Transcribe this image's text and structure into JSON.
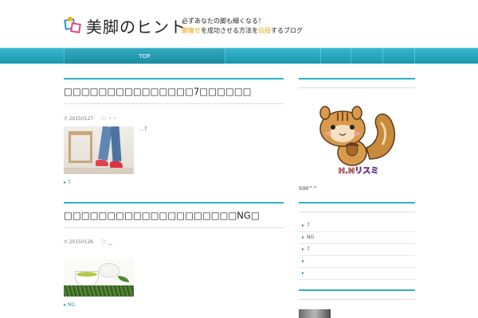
{
  "header": {
    "site_title": "美脚のヒント",
    "tagline_line1": "必ずあなたの脚も細くなる！",
    "tagline_line2_a": "脚痩せ",
    "tagline_line2_b": "を成功させる方法を",
    "tagline_line2_c": "伝授",
    "tagline_line2_d": "するブログ"
  },
  "nav": {
    "top_label": "TOP"
  },
  "posts": [
    {
      "title": "□□□□□□□□□□□□□□□7□□□□□□",
      "date": "20150127",
      "category": "・・",
      "excerpt": "…7",
      "tag": "7"
    },
    {
      "title": "□□□□□□□□□□□□□□□□□□□□NG□",
      "date": "20150126",
      "category": "__",
      "tag": "NG"
    }
  ],
  "sidebar": {
    "mascot_label": "H.Nリスミ",
    "profile_text": "500^^",
    "links": [
      "7",
      "NG",
      "7",
      "",
      ""
    ]
  },
  "colors": {
    "accent": "#2fb0c6",
    "nav": "#1a98b0",
    "highlight": "#e8a000"
  }
}
